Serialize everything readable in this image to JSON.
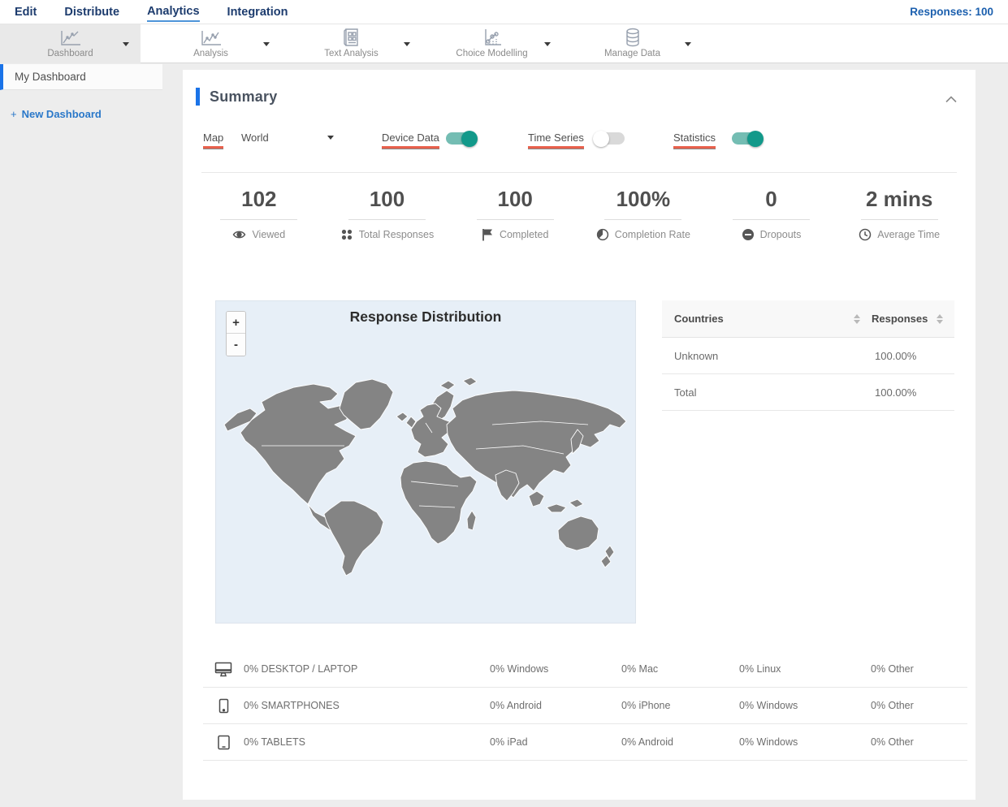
{
  "nav": {
    "items": [
      {
        "label": "Edit",
        "active": false
      },
      {
        "label": "Distribute",
        "active": false
      },
      {
        "label": "Analytics",
        "active": true
      },
      {
        "label": "Integration",
        "active": false
      }
    ],
    "responses_label": "Responses: 100"
  },
  "toolbar": {
    "tabs": [
      {
        "label": "Dashboard",
        "icon": "line-chart",
        "selected": true
      },
      {
        "label": "Analysis",
        "icon": "line-chart",
        "selected": false
      },
      {
        "label": "Text Analysis",
        "icon": "document-grid",
        "selected": false
      },
      {
        "label": "Choice Modelling",
        "icon": "scatter-chart",
        "selected": false
      },
      {
        "label": "Manage Data",
        "icon": "database",
        "selected": false
      }
    ]
  },
  "sidebar": {
    "items": [
      {
        "label": "My Dashboard",
        "selected": true
      }
    ],
    "new_dashboard_label": "New Dashboard",
    "new_dashboard_plus": "+"
  },
  "summary": {
    "title": "Summary",
    "controls": {
      "map_label": "Map",
      "map_value": "World",
      "device_data_label": "Device Data",
      "device_data_on": true,
      "time_series_label": "Time Series",
      "time_series_on": false,
      "statistics_label": "Statistics",
      "statistics_on": true
    },
    "stats": [
      {
        "value": "102",
        "label": "Viewed",
        "icon": "eye"
      },
      {
        "value": "100",
        "label": "Total Responses",
        "icon": "dots-grid"
      },
      {
        "value": "100",
        "label": "Completed",
        "icon": "flag"
      },
      {
        "value": "100%",
        "label": "Completion Rate",
        "icon": "half-circle"
      },
      {
        "value": "0",
        "label": "Dropouts",
        "icon": "minus-circle"
      },
      {
        "value": "2 mins",
        "label": "Average Time",
        "icon": "clock"
      }
    ],
    "map": {
      "title": "Response Distribution",
      "zoom_in": "+",
      "zoom_out": "-"
    },
    "countries_table": {
      "headers": {
        "countries": "Countries",
        "responses": "Responses"
      },
      "rows": [
        {
          "name": "Unknown",
          "value": "100.00%"
        },
        {
          "name": "Total",
          "value": "100.00%"
        }
      ]
    },
    "devices": [
      {
        "label": "0% DESKTOP / LAPTOP",
        "icon": "desktop",
        "cols": [
          "0% Windows",
          "0% Mac",
          "0% Linux",
          "0% Other"
        ]
      },
      {
        "label": "0% SMARTPHONES",
        "icon": "smartphone",
        "cols": [
          "0% Android",
          "0% iPhone",
          "0% Windows",
          "0% Other"
        ]
      },
      {
        "label": "0% TABLETS",
        "icon": "tablet",
        "cols": [
          "0% iPad",
          "0% Android",
          "0% Windows",
          "0% Other"
        ]
      }
    ]
  },
  "colors": {
    "nav_text": "#1d3c6e",
    "active_underline": "#4e95d9",
    "accent_blue": "#1a73e8",
    "toggle_on": "#12998a",
    "label_underline_red": "#e8604c",
    "map_background": "#e7eff7",
    "map_land": "#848484"
  }
}
